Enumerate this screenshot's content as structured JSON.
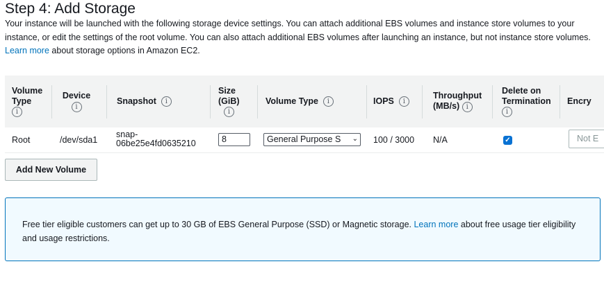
{
  "page": {
    "title": "Step 4: Add Storage",
    "intro": {
      "text": "Your instance will be launched with the following storage device settings. You can attach additional EBS volumes and instance store volumes to your instance, or edit the settings of the root volume. You can also attach additional EBS volumes after launching an instance, but not instance store volumes.",
      "link": "Learn more",
      "suffix": "about storage options in Amazon EC2."
    }
  },
  "table": {
    "info_glyph": "i",
    "headers": {
      "volume_type": "Volume Type",
      "device": "Device",
      "snapshot": "Snapshot",
      "size": "Size (GiB)",
      "ebs_volume_type": "Volume Type",
      "iops": "IOPS",
      "throughput": "Throughput (MB/s)",
      "delete_on_termination": "Delete on Termination",
      "encryption": "Encry"
    },
    "row": {
      "volume_type": "Root",
      "device": "/dev/sda1",
      "snapshot": "snap-06be25e4fd0635210",
      "size": "8",
      "ebs_volume_type": "General Purpose S",
      "iops": "100 / 3000",
      "throughput": "N/A",
      "delete_on_termination": true,
      "encryption": "Not E"
    }
  },
  "buttons": {
    "add_volume": "Add New Volume"
  },
  "notice": {
    "text": "Free tier eligible customers can get up to 30 GB of EBS General Purpose (SSD) or Magnetic storage.",
    "link": "Learn more",
    "suffix": "about free usage tier eligibility and usage restrictions."
  },
  "colors": {
    "link": "#0073bb",
    "checkbox": "#0972d3",
    "notice_border": "#0073bb",
    "notice_bg": "#f1faff"
  }
}
